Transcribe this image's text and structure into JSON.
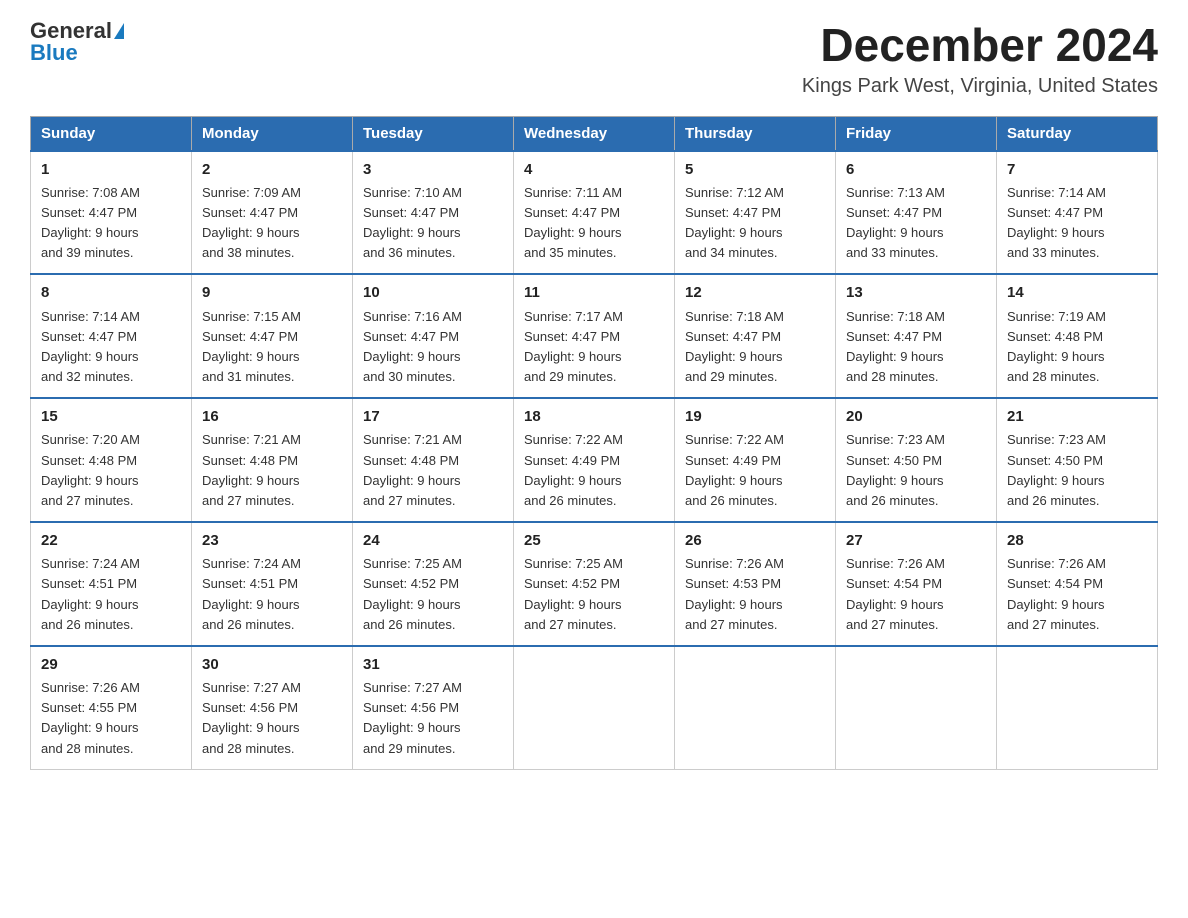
{
  "header": {
    "logo_general": "General",
    "logo_blue": "Blue",
    "main_title": "December 2024",
    "subtitle": "Kings Park West, Virginia, United States"
  },
  "days_of_week": [
    "Sunday",
    "Monday",
    "Tuesday",
    "Wednesday",
    "Thursday",
    "Friday",
    "Saturday"
  ],
  "weeks": [
    [
      {
        "day": "1",
        "sunrise": "7:08 AM",
        "sunset": "4:47 PM",
        "daylight": "9 hours and 39 minutes."
      },
      {
        "day": "2",
        "sunrise": "7:09 AM",
        "sunset": "4:47 PM",
        "daylight": "9 hours and 38 minutes."
      },
      {
        "day": "3",
        "sunrise": "7:10 AM",
        "sunset": "4:47 PM",
        "daylight": "9 hours and 36 minutes."
      },
      {
        "day": "4",
        "sunrise": "7:11 AM",
        "sunset": "4:47 PM",
        "daylight": "9 hours and 35 minutes."
      },
      {
        "day": "5",
        "sunrise": "7:12 AM",
        "sunset": "4:47 PM",
        "daylight": "9 hours and 34 minutes."
      },
      {
        "day": "6",
        "sunrise": "7:13 AM",
        "sunset": "4:47 PM",
        "daylight": "9 hours and 33 minutes."
      },
      {
        "day": "7",
        "sunrise": "7:14 AM",
        "sunset": "4:47 PM",
        "daylight": "9 hours and 33 minutes."
      }
    ],
    [
      {
        "day": "8",
        "sunrise": "7:14 AM",
        "sunset": "4:47 PM",
        "daylight": "9 hours and 32 minutes."
      },
      {
        "day": "9",
        "sunrise": "7:15 AM",
        "sunset": "4:47 PM",
        "daylight": "9 hours and 31 minutes."
      },
      {
        "day": "10",
        "sunrise": "7:16 AM",
        "sunset": "4:47 PM",
        "daylight": "9 hours and 30 minutes."
      },
      {
        "day": "11",
        "sunrise": "7:17 AM",
        "sunset": "4:47 PM",
        "daylight": "9 hours and 29 minutes."
      },
      {
        "day": "12",
        "sunrise": "7:18 AM",
        "sunset": "4:47 PM",
        "daylight": "9 hours and 29 minutes."
      },
      {
        "day": "13",
        "sunrise": "7:18 AM",
        "sunset": "4:47 PM",
        "daylight": "9 hours and 28 minutes."
      },
      {
        "day": "14",
        "sunrise": "7:19 AM",
        "sunset": "4:48 PM",
        "daylight": "9 hours and 28 minutes."
      }
    ],
    [
      {
        "day": "15",
        "sunrise": "7:20 AM",
        "sunset": "4:48 PM",
        "daylight": "9 hours and 27 minutes."
      },
      {
        "day": "16",
        "sunrise": "7:21 AM",
        "sunset": "4:48 PM",
        "daylight": "9 hours and 27 minutes."
      },
      {
        "day": "17",
        "sunrise": "7:21 AM",
        "sunset": "4:48 PM",
        "daylight": "9 hours and 27 minutes."
      },
      {
        "day": "18",
        "sunrise": "7:22 AM",
        "sunset": "4:49 PM",
        "daylight": "9 hours and 26 minutes."
      },
      {
        "day": "19",
        "sunrise": "7:22 AM",
        "sunset": "4:49 PM",
        "daylight": "9 hours and 26 minutes."
      },
      {
        "day": "20",
        "sunrise": "7:23 AM",
        "sunset": "4:50 PM",
        "daylight": "9 hours and 26 minutes."
      },
      {
        "day": "21",
        "sunrise": "7:23 AM",
        "sunset": "4:50 PM",
        "daylight": "9 hours and 26 minutes."
      }
    ],
    [
      {
        "day": "22",
        "sunrise": "7:24 AM",
        "sunset": "4:51 PM",
        "daylight": "9 hours and 26 minutes."
      },
      {
        "day": "23",
        "sunrise": "7:24 AM",
        "sunset": "4:51 PM",
        "daylight": "9 hours and 26 minutes."
      },
      {
        "day": "24",
        "sunrise": "7:25 AM",
        "sunset": "4:52 PM",
        "daylight": "9 hours and 26 minutes."
      },
      {
        "day": "25",
        "sunrise": "7:25 AM",
        "sunset": "4:52 PM",
        "daylight": "9 hours and 27 minutes."
      },
      {
        "day": "26",
        "sunrise": "7:26 AM",
        "sunset": "4:53 PM",
        "daylight": "9 hours and 27 minutes."
      },
      {
        "day": "27",
        "sunrise": "7:26 AM",
        "sunset": "4:54 PM",
        "daylight": "9 hours and 27 minutes."
      },
      {
        "day": "28",
        "sunrise": "7:26 AM",
        "sunset": "4:54 PM",
        "daylight": "9 hours and 27 minutes."
      }
    ],
    [
      {
        "day": "29",
        "sunrise": "7:26 AM",
        "sunset": "4:55 PM",
        "daylight": "9 hours and 28 minutes."
      },
      {
        "day": "30",
        "sunrise": "7:27 AM",
        "sunset": "4:56 PM",
        "daylight": "9 hours and 28 minutes."
      },
      {
        "day": "31",
        "sunrise": "7:27 AM",
        "sunset": "4:56 PM",
        "daylight": "9 hours and 29 minutes."
      },
      null,
      null,
      null,
      null
    ]
  ],
  "labels": {
    "sunrise": "Sunrise:",
    "sunset": "Sunset:",
    "daylight": "Daylight:"
  }
}
